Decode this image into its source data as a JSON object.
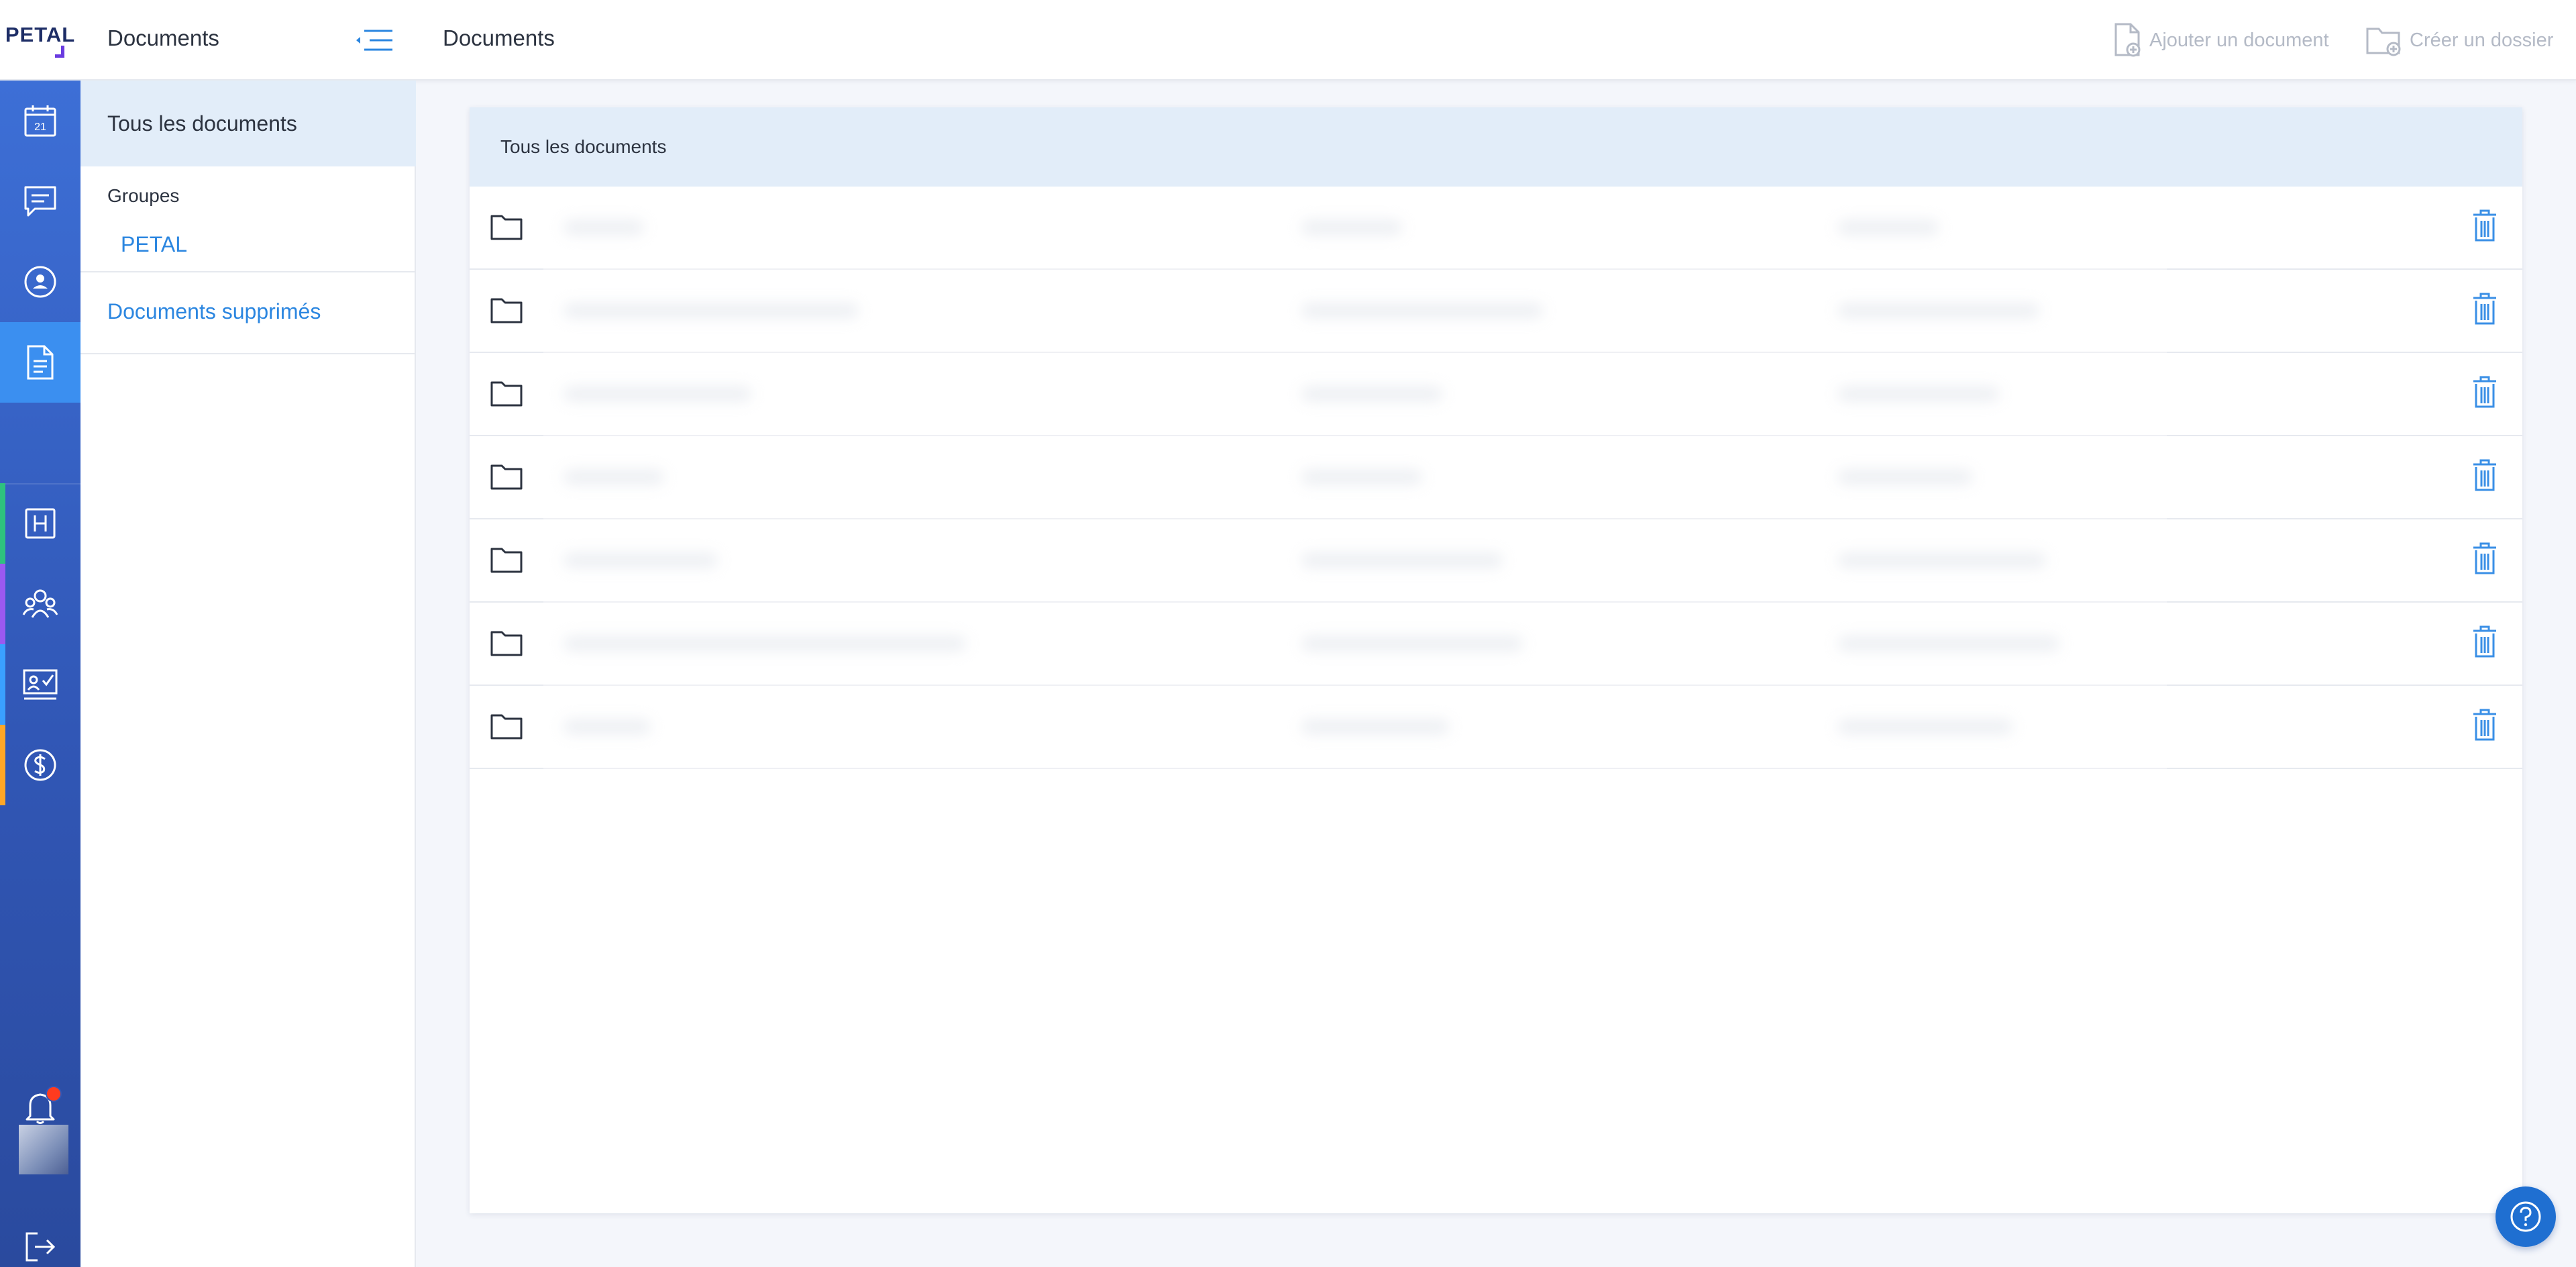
{
  "brand": {
    "logo_text": "PETAL"
  },
  "header": {
    "panel_title": "Documents",
    "page_title": "Documents",
    "actions": {
      "add_document": "Ajouter un document",
      "create_folder": "Créer un dossier"
    }
  },
  "rail": {
    "items": [
      {
        "icon": "calendar-icon",
        "label": "21"
      },
      {
        "icon": "chat-icon"
      },
      {
        "icon": "user-circle-icon"
      },
      {
        "icon": "document-icon",
        "active": true
      },
      {
        "icon": "blank"
      },
      {
        "icon": "hospital-icon",
        "accent": "#2ec27e"
      },
      {
        "icon": "team-icon",
        "accent": "#9b59f0"
      },
      {
        "icon": "checklist-icon",
        "accent": "#3aa0ff"
      },
      {
        "icon": "dollar-icon",
        "accent": "#ffa726"
      }
    ],
    "bottom": {
      "notification_icon": "bell-icon",
      "logout_icon": "logout-icon"
    }
  },
  "sidebar": {
    "all_documents": "Tous les documents",
    "groups_label": "Groupes",
    "groups": [
      "PETAL"
    ],
    "deleted": "Documents supprimés"
  },
  "main": {
    "card_title": "Tous les documents",
    "row_count": 7
  },
  "colors": {
    "rail_top": "#3d6fd6",
    "rail_active": "#3b8ff0",
    "link": "#2b86e0",
    "selected_bg": "#e2edf9",
    "help_button": "#1f6fd1",
    "notification": "#ff3b1f"
  }
}
